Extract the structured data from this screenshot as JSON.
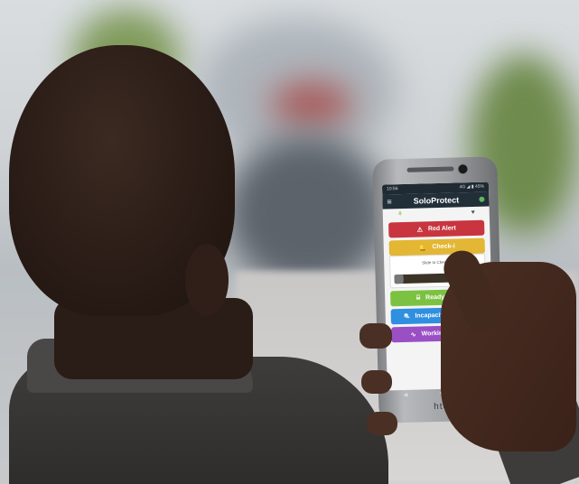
{
  "photo": {
    "description_icons": [
      "menu-icon",
      "alert-triangle-icon",
      "bell-icon",
      "walkie-talkie-icon",
      "fall-icon",
      "pulse-icon"
    ]
  },
  "phone": {
    "status_time": "10:56",
    "status_right": "4G ◢ ▮ 45%",
    "app_title": "SoloProtect",
    "buttons": {
      "red_alert": "Red Alert",
      "check_in": "Check-i",
      "slide_to_check_in": "Slide to Check-in",
      "ready2talk": "Ready2Talk",
      "incapacitation_alert": "Incapacitation Alert",
      "working_status": "Working Status"
    },
    "brand": "htc"
  },
  "colors": {
    "red": "#c8353f",
    "yellow": "#e3b634",
    "green": "#7cc242",
    "blue": "#2f8fe0",
    "purple": "#9b4fc4",
    "appbar": "#222e38"
  }
}
